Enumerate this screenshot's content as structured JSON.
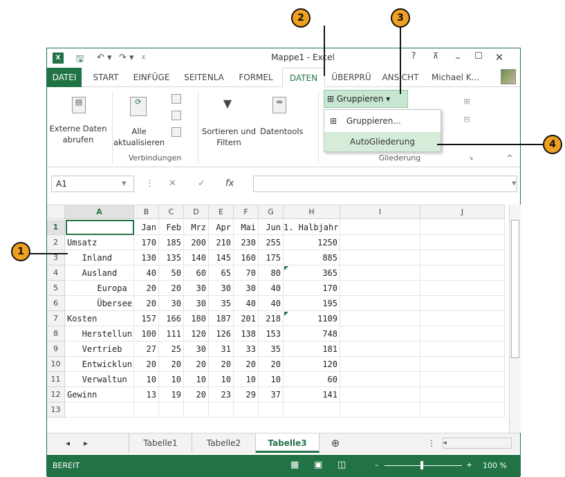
{
  "title": "Mappe1 - Excel",
  "help": "?",
  "tabs": [
    "DATEI",
    "START",
    "EINFÜGE",
    "SEITENLA",
    "FORMEL",
    "DATEN",
    "ÜBERPRÜ",
    "ANSICHT"
  ],
  "user": "Michael K...",
  "ribbon": {
    "externe_daten": "Externe Daten abrufen",
    "alle": "Alle",
    "aktualisieren": "aktualisieren",
    "sortieren": "Sortieren und Filtern",
    "datentools": "Datentools",
    "gruppieren": "Gruppieren",
    "verbindungen": "Verbindungen",
    "gliederung": "Gliederung",
    "dd_gruppieren": "Gruppieren...",
    "dd_auto": "AutoGliederung"
  },
  "namebox": "A1",
  "fx": "fx",
  "columns": [
    "A",
    "B",
    "C",
    "D",
    "E",
    "F",
    "G",
    "H",
    "I",
    "J"
  ],
  "rows": [
    [
      "",
      "Jan",
      "Feb",
      "Mrz",
      "Apr",
      "Mai",
      "Jun",
      "1. Halbjahr"
    ],
    [
      "Umsatz",
      "170",
      "185",
      "200",
      "210",
      "230",
      "255",
      "1250"
    ],
    [
      "   Inland",
      "130",
      "135",
      "140",
      "145",
      "160",
      "175",
      "885"
    ],
    [
      "   Ausland",
      "40",
      "50",
      "60",
      "65",
      "70",
      "80",
      "365"
    ],
    [
      "      Europa",
      "20",
      "20",
      "30",
      "30",
      "30",
      "40",
      "170"
    ],
    [
      "      Übersee",
      "20",
      "30",
      "30",
      "35",
      "40",
      "40",
      "195"
    ],
    [
      "Kosten",
      "157",
      "166",
      "180",
      "187",
      "201",
      "218",
      "1109"
    ],
    [
      "   Herstellun",
      "100",
      "111",
      "120",
      "126",
      "138",
      "153",
      "748"
    ],
    [
      "   Vertrieb",
      "27",
      "25",
      "30",
      "31",
      "33",
      "35",
      "181"
    ],
    [
      "   Entwicklun",
      "20",
      "20",
      "20",
      "20",
      "20",
      "20",
      "120"
    ],
    [
      "   Verwaltun",
      "10",
      "10",
      "10",
      "10",
      "10",
      "10",
      "60"
    ],
    [
      "Gewinn",
      "13",
      "19",
      "20",
      "23",
      "29",
      "37",
      "141"
    ],
    [
      "",
      "",
      "",
      "",
      "",
      "",
      "",
      ""
    ]
  ],
  "sheets": [
    "Tabelle1",
    "Tabelle2",
    "Tabelle3"
  ],
  "status": "BEREIT",
  "zoom": "100 %",
  "callouts": [
    "1",
    "2",
    "3",
    "4"
  ],
  "colors": {
    "excel_green": "#217346",
    "callout": "#f0a020"
  }
}
